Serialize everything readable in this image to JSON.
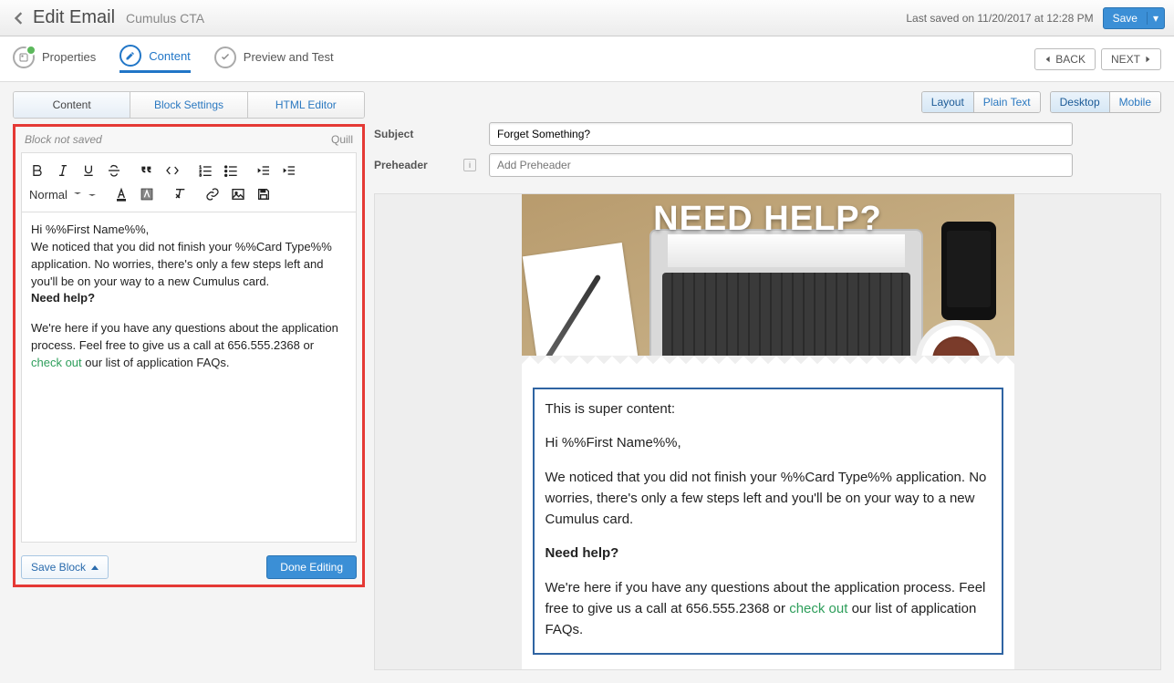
{
  "header": {
    "title": "Edit Email",
    "subtitle": "Cumulus CTA",
    "lastSaved": "Last saved on 11/20/2017 at 12:28 PM",
    "saveLabel": "Save"
  },
  "steps": {
    "properties": "Properties",
    "content": "Content",
    "preview": "Preview and Test",
    "back": "BACK",
    "next": "NEXT"
  },
  "leftPanel": {
    "tabs": {
      "content": "Content",
      "blockSettings": "Block Settings",
      "htmlEditor": "HTML Editor"
    },
    "blockStatus": "Block not saved",
    "quill": "Quill",
    "styleSelect": "Normal",
    "body": {
      "greeting": "Hi %%First Name%%,",
      "p1": "We noticed that you did not finish your %%Card Type%% application. No worries, there's only a few steps left and you'll be on your way to a new Cumulus card.",
      "help": "Need help?",
      "p2a": "We're here if you have any questions about the application process. Feel free to give us a call at 656.555.2368 or ",
      "link": "check out",
      "p2b": " our list of application FAQs."
    },
    "saveBlock": "Save Block",
    "doneEditing": "Done Editing"
  },
  "rightPanel": {
    "viewModes": {
      "layout": "Layout",
      "plainText": "Plain Text",
      "desktop": "Desktop",
      "mobile": "Mobile"
    },
    "subjectLabel": "Subject",
    "subjectValue": "Forget Something?",
    "preheaderLabel": "Preheader",
    "preheaderPlaceholder": "Add Preheader",
    "heroText": "NEED HELP?",
    "preview": {
      "lead": "This is super content:",
      "greeting": "Hi %%First Name%%,",
      "p1": "We noticed that you did not finish your %%Card Type%% application. No worries, there's only a few steps left and you'll be on your way to a new Cumulus card.",
      "help": "Need help?",
      "p2a": "We're here if you have any questions about the application process. Feel free to give us a call at 656.555.2368 or ",
      "link": "check out",
      "p2b": " our list of application FAQs."
    }
  }
}
